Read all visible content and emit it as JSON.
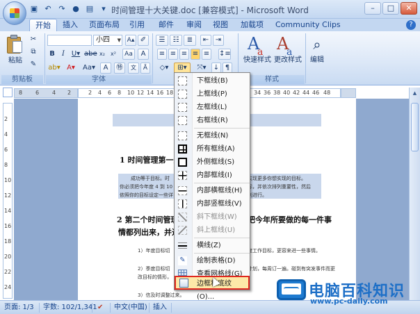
{
  "window": {
    "title": "时间管理十大关键.doc [兼容模式] - Microsoft Word",
    "controls": [
      "–",
      "□",
      "✕"
    ]
  },
  "tabs": [
    "开始",
    "插入",
    "页面布局",
    "引用",
    "邮件",
    "审阅",
    "视图",
    "加载项",
    "Community Clips"
  ],
  "ribbon": {
    "paste_label": "粘贴",
    "clipboard_label": "剪贴板",
    "font_name": "",
    "font_size": "小四",
    "font_label": "字体",
    "quick_styles_label": "快速样式",
    "change_styles_label": "更改样式",
    "styles_label": "样式",
    "edit_label": "编辑"
  },
  "ruler": {
    "h_numbers": [
      "8",
      "6",
      "4",
      "2",
      "2",
      "4",
      "6",
      "8",
      "10",
      "12",
      "14",
      "16",
      "18",
      "20",
      "22",
      "24",
      "26",
      "28",
      "30",
      "32",
      "34",
      "36",
      "38",
      "40",
      "42",
      "44",
      "46",
      "48"
    ],
    "v_numbers": [
      "2",
      "4",
      "6",
      "8",
      "10",
      "12",
      "14",
      "16",
      "18",
      "20",
      "22",
      "24"
    ]
  },
  "document": {
    "heading1": "1  时间管理第一大",
    "para1_line1": "成功等于目标。时",
    "para1_line1b": "实现更多你想实现的目标。",
    "para1_line2": "你必须把今年度 4 到 10",
    "para1_line2b": "标，并依次排列重要性，然后",
    "para1_line3": "依照你的目标设定一些详",
    "para1_line3b": "划进行。",
    "heading2_a": "2  第二个时间管理",
    "heading2_b": "把今年所要做的每一件事",
    "heading2_c": "情都列出来，并进行",
    "item1": "1）年度目标切",
    "item1b": "度工作目标，更容来进一些事情。",
    "item2": "2）季度目标切",
    "item2b": "计划，每周订一遍。碰到有突发事件而更",
    "item2c": "改目标的情形，",
    "item3": "3）信及时调整过来。"
  },
  "menu": {
    "items": [
      {
        "label": "下框线(B)",
        "disabled": false
      },
      {
        "label": "上框线(P)",
        "disabled": false
      },
      {
        "label": "左框线(L)",
        "disabled": false
      },
      {
        "label": "右框线(R)",
        "disabled": false
      },
      {
        "label": "无框线(N)",
        "disabled": false
      },
      {
        "label": "所有框线(A)",
        "disabled": false
      },
      {
        "label": "外侧框线(S)",
        "disabled": false
      },
      {
        "label": "内部框线(I)",
        "disabled": false
      },
      {
        "label": "内部横框线(H)",
        "disabled": false
      },
      {
        "label": "内部竖框线(V)",
        "disabled": false
      },
      {
        "label": "斜下框线(W)",
        "disabled": true
      },
      {
        "label": "斜上框线(U)",
        "disabled": true
      },
      {
        "label": "横线(Z)",
        "disabled": false
      },
      {
        "label": "绘制表格(D)",
        "disabled": false
      },
      {
        "label": "查看网格线(G)",
        "disabled": false
      },
      {
        "label": "边框和底纹(O)...",
        "disabled": false,
        "highlighted": true
      }
    ]
  },
  "statusbar": {
    "page": "页面: 1/3",
    "words": "字数: 102/1,341",
    "language": "中文(中国)",
    "mode": "插入"
  },
  "watermark": {
    "title": "电脑百科知识",
    "url": "www.pc-daily.com"
  }
}
